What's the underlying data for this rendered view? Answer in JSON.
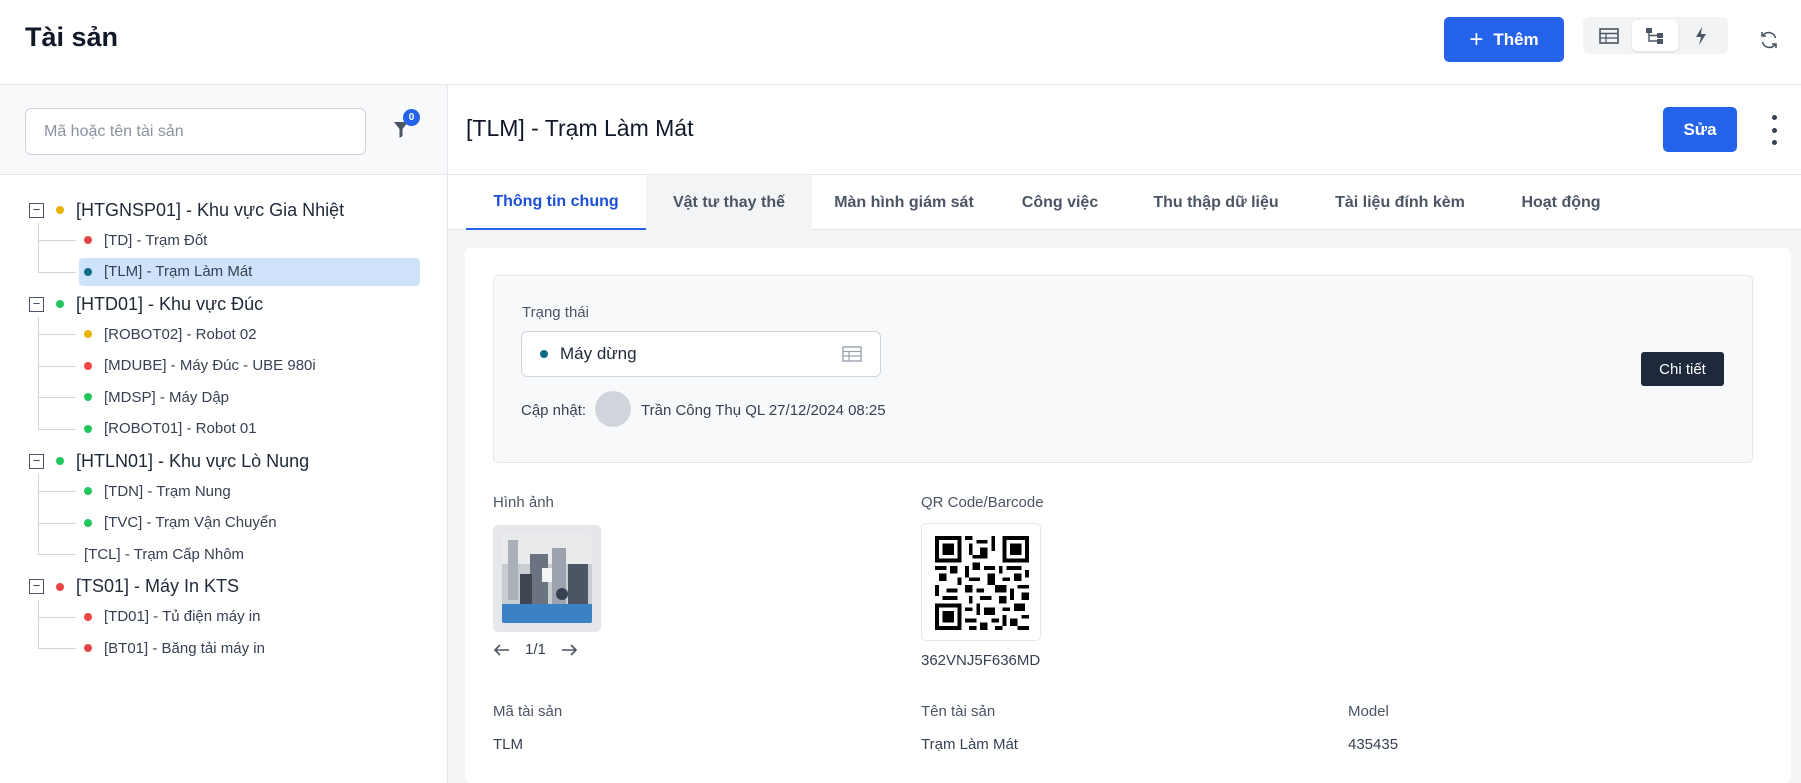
{
  "app": {
    "title": "Tài sản",
    "add_label": "Thêm"
  },
  "search": {
    "placeholder": "Mã hoặc tên tài sản",
    "filter_count": "0"
  },
  "tree": {
    "groups": [
      {
        "label": "[HTGNSP01] - Khu vực Gia Nhiệt",
        "status": "#eab308",
        "children": [
          {
            "label": "[TD] - Trạm Đốt",
            "status": "#ef4444"
          },
          {
            "label": "[TLM] - Trạm Làm Mát",
            "status": "#0e6d86",
            "selected": true
          }
        ]
      },
      {
        "label": "[HTD01] - Khu vực Đúc",
        "status": "#22c55e",
        "children": [
          {
            "label": "[ROBOT02] - Robot 02",
            "status": "#eab308"
          },
          {
            "label": "[MDUBE] - Máy Đúc - UBE 980i",
            "status": "#ef4444"
          },
          {
            "label": "[MDSP] - Máy Dập",
            "status": "#22c55e"
          },
          {
            "label": "[ROBOT01] - Robot 01",
            "status": "#22c55e"
          }
        ]
      },
      {
        "label": "[HTLN01] - Khu vực Lò Nung",
        "status": "#22c55e",
        "children": [
          {
            "label": "[TDN] - Trạm Nung",
            "status": "#22c55e"
          },
          {
            "label": "[TVC] - Trạm Vận Chuyển",
            "status": "#22c55e"
          },
          {
            "label": "[TCL] - Trạm Cấp Nhôm",
            "status": ""
          }
        ]
      },
      {
        "label": "[TS01] - Máy In KTS",
        "status": "#ef4444",
        "children": [
          {
            "label": "[TD01] - Tủ điện máy in",
            "status": "#ef4444"
          },
          {
            "label": "[BT01] - Băng tải máy in",
            "status": "#ef4444"
          }
        ]
      }
    ]
  },
  "detail": {
    "title": "[TLM] - Trạm Làm Mát",
    "edit_label": "Sửa",
    "tabs": [
      "Thông tin chung",
      "Vật tư thay thế",
      "Màn hình giám sát",
      "Công việc",
      "Thu thập dữ liệu",
      "Tài liệu đính kèm",
      "Hoạt động"
    ],
    "active_tab": 0,
    "status_label": "Trạng thái",
    "status_value": "Máy dừng",
    "status_color": "#0e6d86",
    "updated_label": "Cập nhật:",
    "updated_text": "Trần Công Thụ QL 27/12/2024 08:25",
    "detail_button": "Chi tiết",
    "image_label": "Hình ảnh",
    "image_pager": "1/1",
    "qr_label": "QR Code/Barcode",
    "qr_value": "362VNJ5F636MD",
    "fields": [
      {
        "label": "Mã tài sản",
        "value": "TLM"
      },
      {
        "label": "Tên tài sản",
        "value": "Trạm Làm Mát"
      },
      {
        "label": "Model",
        "value": "435435"
      }
    ]
  },
  "colors": {
    "primary": "#2563eb",
    "dark_button": "#1e293b",
    "selected_row": "#cfe2fb"
  }
}
